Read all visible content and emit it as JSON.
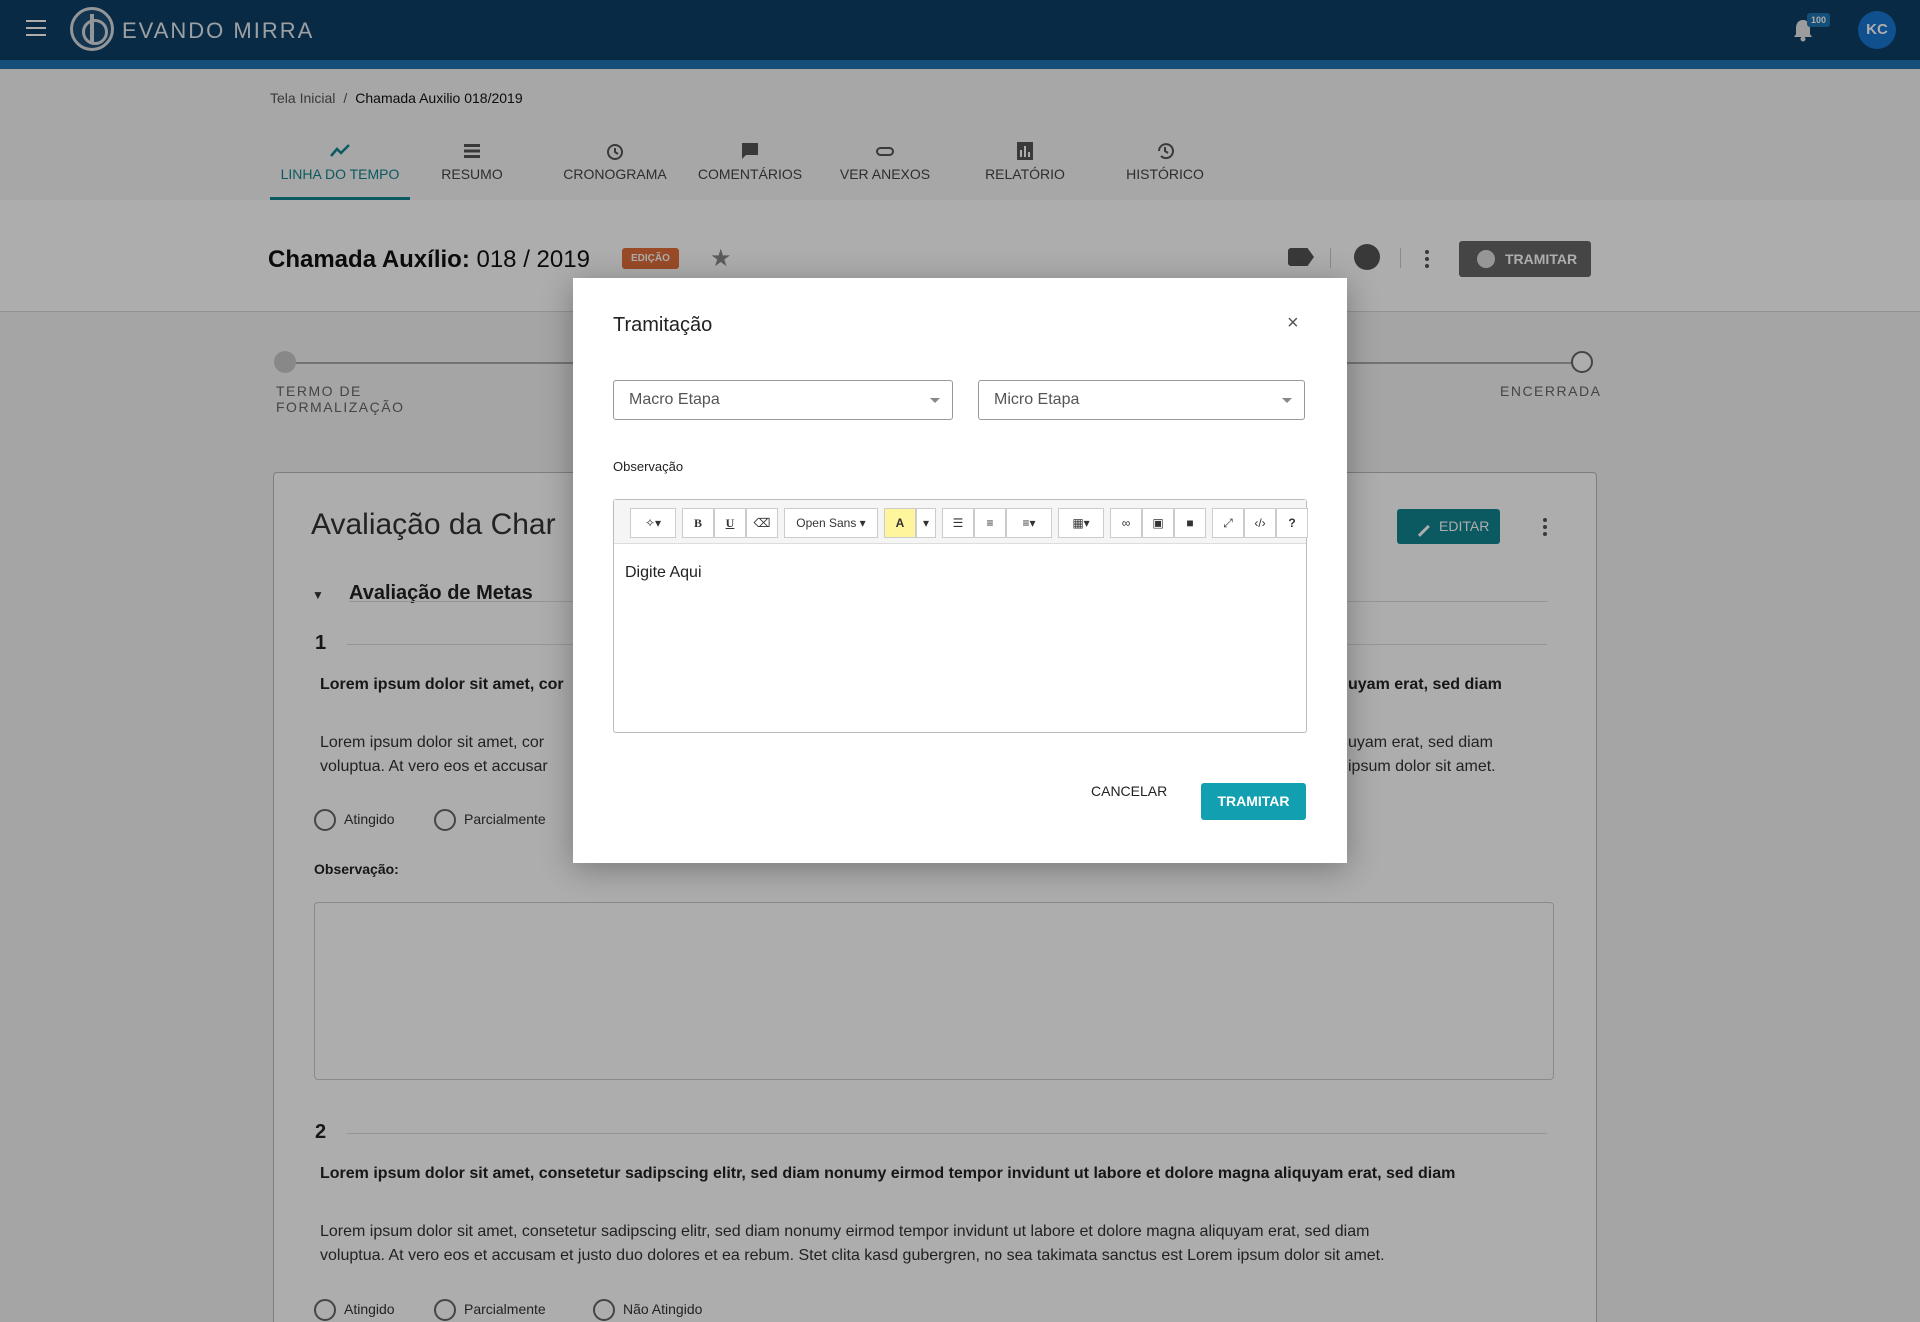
{
  "app": {
    "logo_text": "EVANDO MIRRA",
    "notification_count": "100",
    "user_initials": "KC"
  },
  "breadcrumb": {
    "home": "Tela Inicial",
    "separator": "/",
    "current": "Chamada Auxilio 018/2019"
  },
  "tabs": [
    {
      "label": "LINHA DO TEMPO",
      "icon": "trend-icon",
      "active": true
    },
    {
      "label": "RESUMO",
      "icon": "list-icon"
    },
    {
      "label": "CRONOGRAMA",
      "icon": "alarm-icon"
    },
    {
      "label": "COMENTÁRIOS",
      "icon": "comment-icon"
    },
    {
      "label": "VER ANEXOS",
      "icon": "paperclip-icon"
    },
    {
      "label": "RELATÓRIO",
      "icon": "bar-chart-icon"
    },
    {
      "label": "HISTÓRICO",
      "icon": "history-icon"
    }
  ],
  "header": {
    "title_bold": "Chamada Auxílio:",
    "title_number": "018 / 2019",
    "status_badge": "EDIÇÃO",
    "tramitar_label": "TRAMITAR"
  },
  "stepper": {
    "first_step": "TERMO DE\nFORMALIZAÇÃO",
    "last_step": "ENCERRADA"
  },
  "card": {
    "title": "Avaliação da Char",
    "edit_label": "EDITAR",
    "section_title": "Avaliação de Metas",
    "items": [
      {
        "number": "1",
        "bold_text": "Lorem ipsum dolor sit amet, cor",
        "bold_text_end": "uyam erat, sed diam",
        "text_line1": "Lorem ipsum dolor sit amet, cor",
        "text_line1_end": "uyam erat, sed diam",
        "text_line2": "voluptua. At vero eos et accusar",
        "text_line2_end": "ipsum dolor sit amet.",
        "options": [
          "Atingido",
          "Parcialmente"
        ]
      },
      {
        "number": "2",
        "bold_text": "Lorem ipsum dolor sit amet, consetetur sadipscing elitr, sed diam nonumy eirmod tempor invidunt ut labore et dolore magna aliquyam erat, sed diam",
        "text_line1": "Lorem ipsum dolor sit amet, consetetur sadipscing elitr, sed diam nonumy eirmod tempor invidunt ut labore et dolore magna aliquyam erat, sed diam",
        "text_line2": "voluptua. At vero eos et accusam et justo duo dolores et ea rebum. Stet clita kasd gubergren, no sea takimata sanctus est Lorem ipsum dolor sit amet.",
        "options": [
          "Atingido",
          "Parcialmente",
          "Não Atingido"
        ]
      }
    ],
    "observation_label": "Observação:"
  },
  "modal": {
    "title": "Tramitação",
    "close": "×",
    "macro_placeholder": "Macro Etapa",
    "micro_placeholder": "Micro Etapa",
    "observation_label": "Observação",
    "font_name": "Open Sans",
    "editor_text": "Digite Aqui",
    "cancel_label": "CANCELAR",
    "submit_label": "TRAMITAR"
  },
  "colors": {
    "topbar": "#0d3f66",
    "accent": "#12858f",
    "badge": "#e26f3a",
    "primary_button": "#12a0b0"
  }
}
